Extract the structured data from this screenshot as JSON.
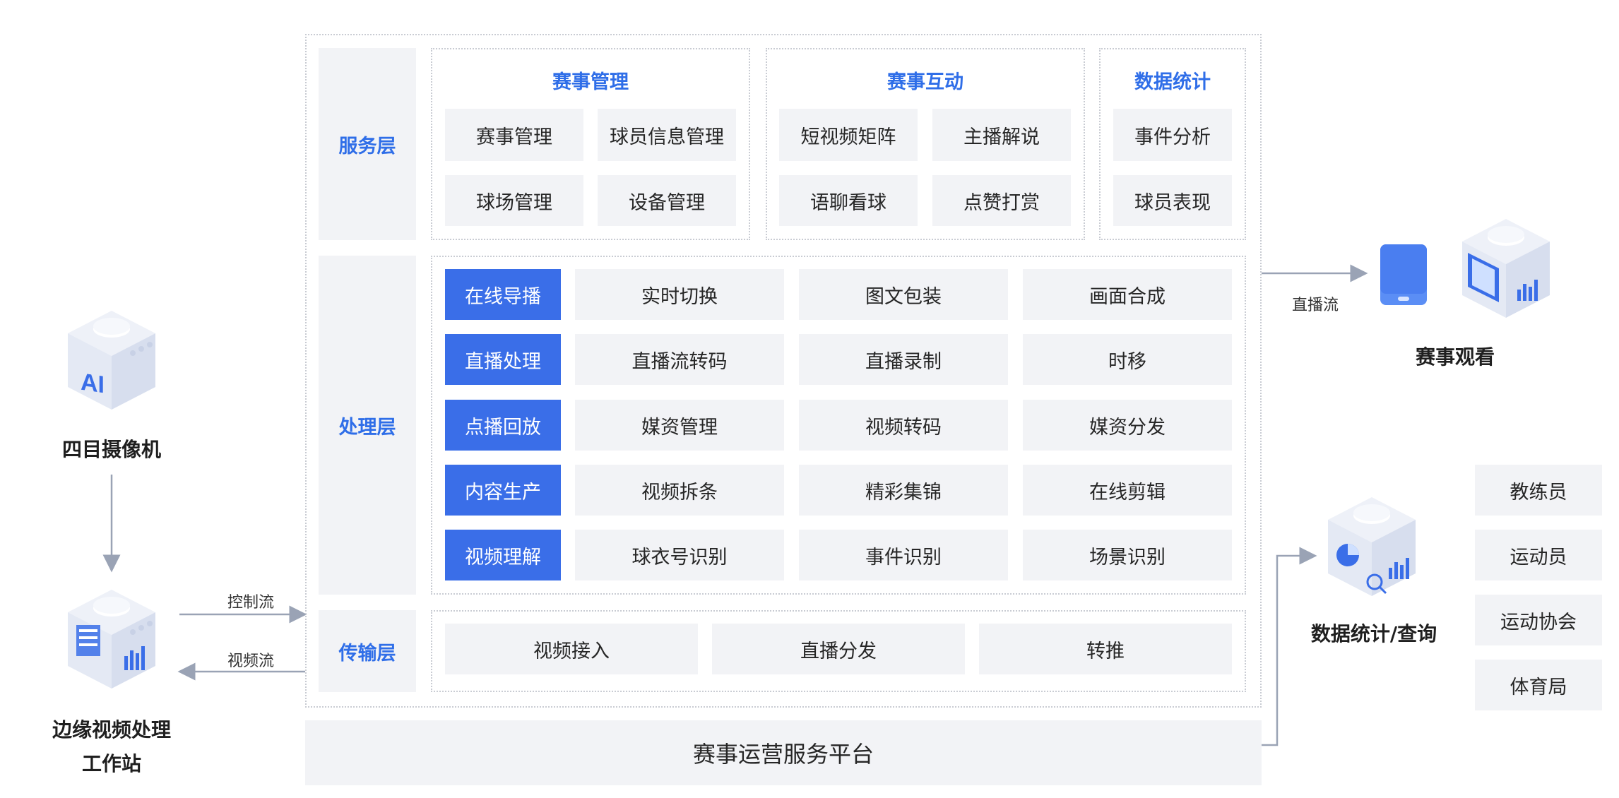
{
  "left": {
    "camera_label": "四目摄像机",
    "edge_label_line1": "边缘视频处理",
    "edge_label_line2": "工作站",
    "ai_text": "AI",
    "control_flow": "控制流",
    "video_flow": "视频流"
  },
  "layers": {
    "service": "服务层",
    "processing": "处理层",
    "transport": "传输层"
  },
  "service_groups": [
    {
      "title": "赛事管理",
      "items": [
        "赛事管理",
        "球员信息管理",
        "球场管理",
        "设备管理"
      ]
    },
    {
      "title": "赛事互动",
      "items": [
        "短视频矩阵",
        "主播解说",
        "语聊看球",
        "点赞打赏"
      ]
    },
    {
      "title": "数据统计",
      "items": [
        "事件分析",
        "球员表现"
      ]
    }
  ],
  "processing_rows": [
    {
      "head": "在线导播",
      "items": [
        "实时切换",
        "图文包装",
        "画面合成"
      ]
    },
    {
      "head": "直播处理",
      "items": [
        "直播流转码",
        "直播录制",
        "时移"
      ]
    },
    {
      "head": "点播回放",
      "items": [
        "媒资管理",
        "视频转码",
        "媒资分发"
      ]
    },
    {
      "head": "内容生产",
      "items": [
        "视频拆条",
        "精彩集锦",
        "在线剪辑"
      ]
    },
    {
      "head": "视频理解",
      "items": [
        "球衣号识别",
        "事件识别",
        "场景识别"
      ]
    }
  ],
  "transport_items": [
    "视频接入",
    "直播分发",
    "转推"
  ],
  "platform": "赛事运营服务平台",
  "right": {
    "live_stream": "直播流",
    "viewing": "赛事观看",
    "stats_query": "数据统计/查询",
    "roles": [
      "教练员",
      "运动员",
      "运动协会",
      "体育局"
    ]
  },
  "colors": {
    "accent": "#2f6ee8",
    "cell_blue": "#3a6ee8",
    "cell_gray": "#f2f3f6",
    "arrow": "#9aa3b5"
  }
}
